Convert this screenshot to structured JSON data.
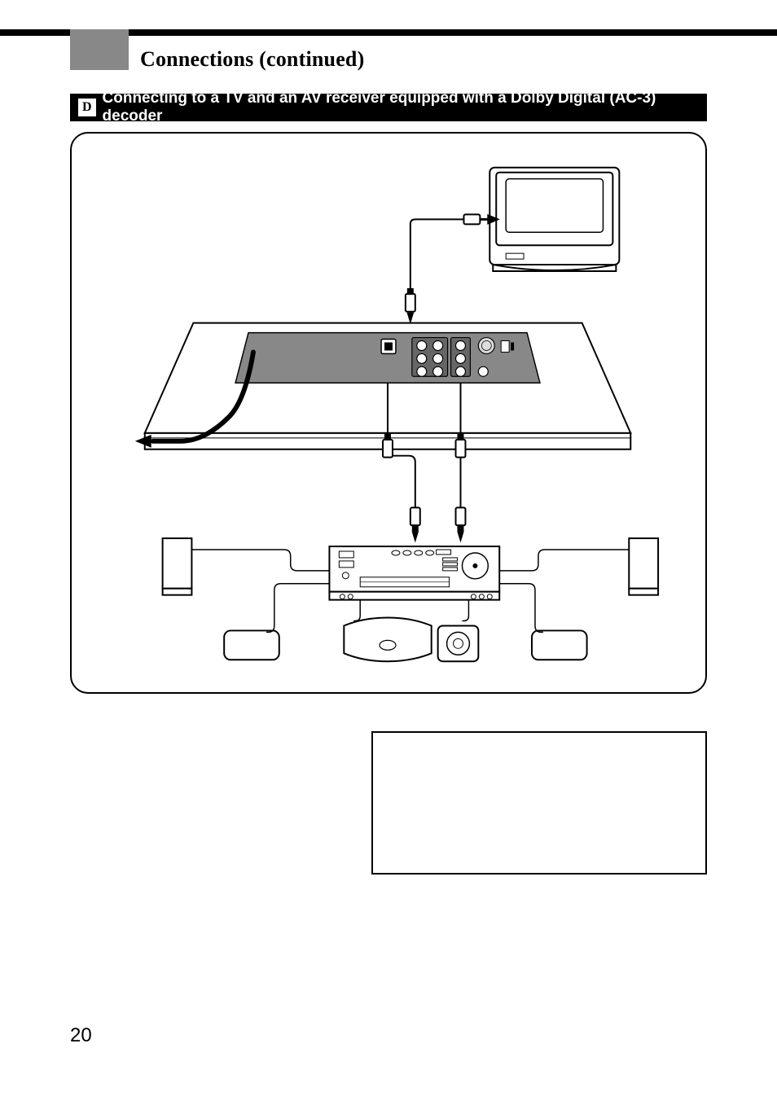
{
  "header": {
    "title": "Connections (continued)"
  },
  "section": {
    "label": "D",
    "subtitle": "Connecting to a TV and an AV receiver equipped with a Dolby Digital (AC-3) decoder"
  },
  "page_number": "20",
  "chart_data": {
    "type": "diagram",
    "description": "Wiring diagram showing a DVD player rear panel connected upward via a video cable to a CRT TV, and downward via optical and coaxial cables to an AV receiver with Dolby Digital decoder. The receiver drives two front speakers, two surround speakers, a subwoofer, and a center speaker. A power cord exits the player to the left.",
    "components": [
      "TV",
      "DVD player (rear panel)",
      "AV receiver",
      "Front speaker L",
      "Front speaker R",
      "Surround speaker L",
      "Surround speaker R",
      "Subwoofer",
      "Center speaker",
      "Power cable"
    ],
    "cables": [
      "Video (player → TV)",
      "Optical digital (player → receiver)",
      "Coaxial digital (player → receiver)",
      "Speaker wires (receiver → 6 speakers)",
      "AC power"
    ]
  }
}
